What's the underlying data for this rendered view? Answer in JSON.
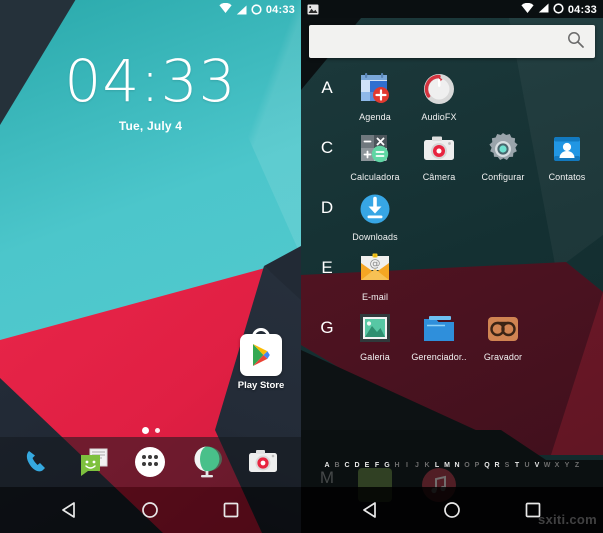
{
  "left_screen": {
    "name": "android-home-screen",
    "statusbar": {
      "time": "04:33",
      "icons": [
        "wifi-icon",
        "signal-icon",
        "battery-icon"
      ]
    },
    "clock_widget": {
      "time": "04:33",
      "date": "Tue, July 4"
    },
    "shortcuts": [
      {
        "label": "Play Store",
        "icon": "play-store-icon"
      }
    ],
    "page_indicator": {
      "pages": 2,
      "current": 1
    },
    "dock": [
      {
        "label": "Phone",
        "icon": "phone-icon"
      },
      {
        "label": "Messaging",
        "icon": "messaging-icon"
      },
      {
        "label": "All Apps",
        "icon": "app-drawer-icon"
      },
      {
        "label": "Browser",
        "icon": "browser-globe-icon"
      },
      {
        "label": "Camera",
        "icon": "camera-icon"
      }
    ],
    "navbar": [
      {
        "label": "Back",
        "icon": "back-triangle-icon"
      },
      {
        "label": "Home",
        "icon": "home-circle-icon"
      },
      {
        "label": "Recents",
        "icon": "recents-square-icon"
      }
    ],
    "colors": {
      "teal": "#4cc6cb",
      "red": "#e62147",
      "navy": "#262f3c"
    }
  },
  "right_screen": {
    "name": "android-app-drawer",
    "statusbar": {
      "time": "04:33",
      "left_icons": [
        "screenshot-photo-icon"
      ],
      "icons": [
        "wifi-icon",
        "signal-icon",
        "battery-icon"
      ]
    },
    "search": {
      "value": "",
      "placeholder": "",
      "icon": "search-icon"
    },
    "sections": [
      {
        "letter": "A",
        "apps": [
          {
            "label": "Agenda",
            "icon": "calendar-icon"
          },
          {
            "label": "AudioFX",
            "icon": "audio-knob-icon"
          }
        ]
      },
      {
        "letter": "C",
        "apps": [
          {
            "label": "Calculadora",
            "icon": "calculator-icon"
          },
          {
            "label": "Câmera",
            "icon": "camera-icon"
          },
          {
            "label": "Configurar",
            "icon": "settings-gear-icon"
          },
          {
            "label": "Contatos",
            "icon": "contacts-icon"
          }
        ]
      },
      {
        "letter": "D",
        "apps": [
          {
            "label": "Downloads",
            "icon": "download-icon"
          }
        ]
      },
      {
        "letter": "E",
        "apps": [
          {
            "label": "E-mail",
            "icon": "email-envelope-icon"
          }
        ]
      },
      {
        "letter": "G",
        "apps": [
          {
            "label": "Galeria",
            "icon": "gallery-photo-icon"
          },
          {
            "label": "Gerenciador..",
            "icon": "file-manager-folder-icon"
          },
          {
            "label": "Gravador",
            "icon": "voice-recorder-icon"
          }
        ]
      }
    ],
    "partial_section": {
      "letter": "M",
      "apps": [
        {
          "label": "",
          "icon": "green-app-icon"
        },
        {
          "label": "",
          "icon": "music-note-icon"
        }
      ]
    },
    "alpha_index": {
      "letters": [
        "A",
        "B",
        "C",
        "D",
        "E",
        "F",
        "G",
        "H",
        "I",
        "J",
        "K",
        "L",
        "M",
        "N",
        "O",
        "P",
        "Q",
        "R",
        "S",
        "T",
        "U",
        "V",
        "W",
        "X",
        "Y",
        "Z"
      ],
      "active": [
        "A",
        "C",
        "D",
        "E",
        "F",
        "G",
        "L",
        "M",
        "N",
        "Q",
        "R",
        "S",
        "T",
        "V"
      ]
    },
    "navbar": [
      {
        "label": "Back",
        "icon": "back-triangle-icon"
      },
      {
        "label": "Home",
        "icon": "home-circle-icon"
      },
      {
        "label": "Recents",
        "icon": "recents-square-icon"
      }
    ],
    "watermark": "sxiti.com",
    "colors": {
      "background": "#143032",
      "accent_red": "#5c1623",
      "search_bg": "#f2f2f0"
    }
  }
}
